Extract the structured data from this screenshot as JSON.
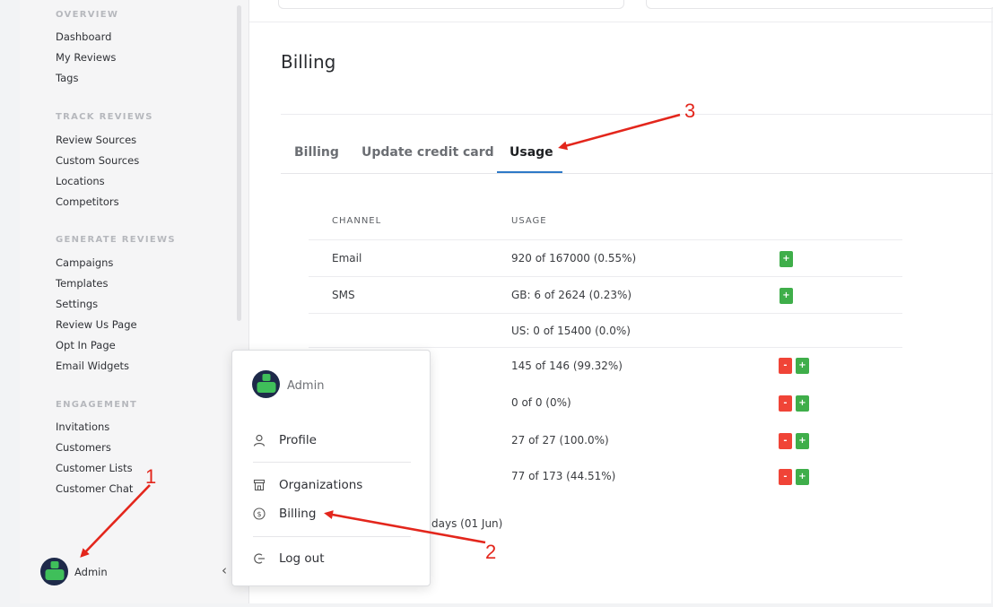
{
  "sidebar": {
    "sections": [
      {
        "title": "OVERVIEW",
        "items": [
          "Dashboard",
          "My Reviews",
          "Tags"
        ]
      },
      {
        "title": "TRACK REVIEWS",
        "items": [
          "Review Sources",
          "Custom Sources",
          "Locations",
          "Competitors"
        ]
      },
      {
        "title": "GENERATE REVIEWS",
        "items": [
          "Campaigns",
          "Templates",
          "Settings",
          "Review Us Page",
          "Opt In Page",
          "Email Widgets"
        ]
      },
      {
        "title": "ENGAGEMENT",
        "items": [
          "Invitations",
          "Customers",
          "Customer Lists",
          "Customer Chat"
        ]
      }
    ],
    "user_name": "Admin",
    "collapse_icon": "chevron-left-icon"
  },
  "main": {
    "title": "Billing",
    "tabs": [
      {
        "label": "Billing",
        "active": false
      },
      {
        "label": "Update credit card",
        "active": false
      },
      {
        "label": "Usage",
        "active": true
      }
    ],
    "table": {
      "headers": [
        "CHANNEL",
        "USAGE"
      ],
      "rows": [
        {
          "channel": "Email",
          "usage": "920 of 167000 (0.55%)",
          "buttons": [
            "+"
          ]
        },
        {
          "channel": "SMS",
          "usage": "GB: 6 of 2624 (0.23%)",
          "buttons": [
            "+"
          ]
        },
        {
          "channel": "",
          "usage": "US: 0 of 15400 (0.0%)",
          "buttons": []
        },
        {
          "channel": "",
          "usage": "145 of 146 (99.32%)",
          "buttons": [
            "-",
            "+"
          ]
        },
        {
          "channel": "",
          "usage": "0 of 0 (0%)",
          "buttons": [
            "-",
            "+"
          ]
        },
        {
          "channel": "",
          "usage": "27 of 27 (100.0%)",
          "buttons": [
            "-",
            "+"
          ]
        },
        {
          "channel": "",
          "usage": "77 of 173 (44.51%)",
          "buttons": [
            "-",
            "+"
          ]
        }
      ]
    },
    "footer_fragment": "days (01 Jun)"
  },
  "user_menu": {
    "user_name": "Admin",
    "items": [
      {
        "label": "Profile",
        "icon": "user-icon"
      },
      {
        "label": "Organizations",
        "icon": "store-icon"
      },
      {
        "label": "Billing",
        "icon": "dollar-circle-icon"
      },
      {
        "label": "Log out",
        "icon": "logout-icon"
      }
    ]
  },
  "annotations": {
    "step1": "1",
    "step2": "2",
    "step3": "3",
    "color": "#e3261c"
  },
  "colors": {
    "accent": "#2d79c7",
    "plus_button": "#3fae4a",
    "minus_button": "#f04437",
    "avatar_bg": "#1e2a4a",
    "avatar_figure": "#3fbf5a"
  }
}
